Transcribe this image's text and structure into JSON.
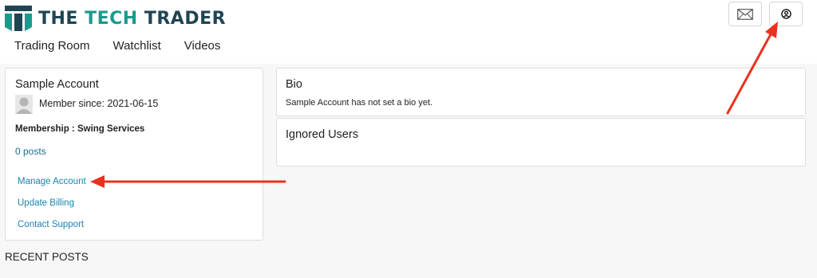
{
  "brand": {
    "prefix": "THE ",
    "accent": "TECH",
    "suffix": " TRADER",
    "colors": {
      "dark": "#1f4552",
      "teal": "#1a9a8d"
    }
  },
  "nav": {
    "items": [
      {
        "label": "Trading Room"
      },
      {
        "label": "Watchlist"
      },
      {
        "label": "Videos"
      }
    ]
  },
  "header_icons": {
    "mail": "mail-icon",
    "user": "user-circle-icon"
  },
  "profile": {
    "name": "Sample Account",
    "member_since": "Member since: 2021-06-15",
    "membership": "Membership : Swing Services",
    "posts": "0 posts",
    "links": [
      {
        "label": "Manage Account"
      },
      {
        "label": "Update Billing"
      },
      {
        "label": "Contact Support"
      }
    ]
  },
  "bio": {
    "title": "Bio",
    "text": "Sample Account has not set a bio yet."
  },
  "ignored_users": {
    "title": "Ignored Users"
  },
  "recent_posts": {
    "title": "RECENT POSTS"
  },
  "annotation_color": "#e8321f"
}
